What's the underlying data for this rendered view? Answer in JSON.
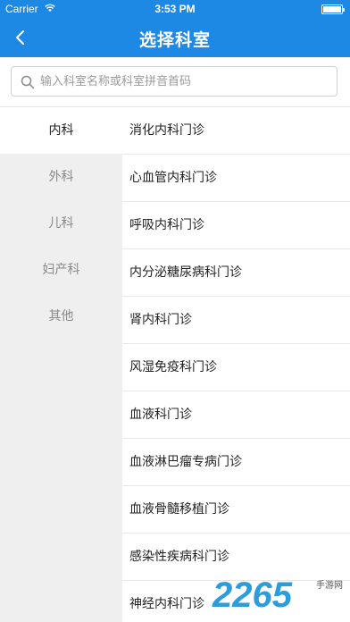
{
  "status_bar": {
    "carrier": "Carrier",
    "time": "3:53 PM"
  },
  "nav": {
    "title": "选择科室"
  },
  "search": {
    "placeholder": "输入科室名称或科室拼音首码"
  },
  "categories": [
    "内科",
    "外科",
    "儿科",
    "妇产科",
    "其他"
  ],
  "active_category_index": 0,
  "departments": [
    "消化内科门诊",
    "心血管内科门诊",
    "呼吸内科门诊",
    "内分泌糖尿病科门诊",
    "肾内科门诊",
    "风湿免疫科门诊",
    "血液科门诊",
    "血液淋巴瘤专病门诊",
    "血液骨髓移植门诊",
    "感染性疾病科门诊",
    "神经内科门诊"
  ],
  "watermark": {
    "number": "2265",
    "label": "手游网"
  },
  "colors": {
    "primary": "#1e88e5",
    "sidebar_bg": "#efefef"
  }
}
